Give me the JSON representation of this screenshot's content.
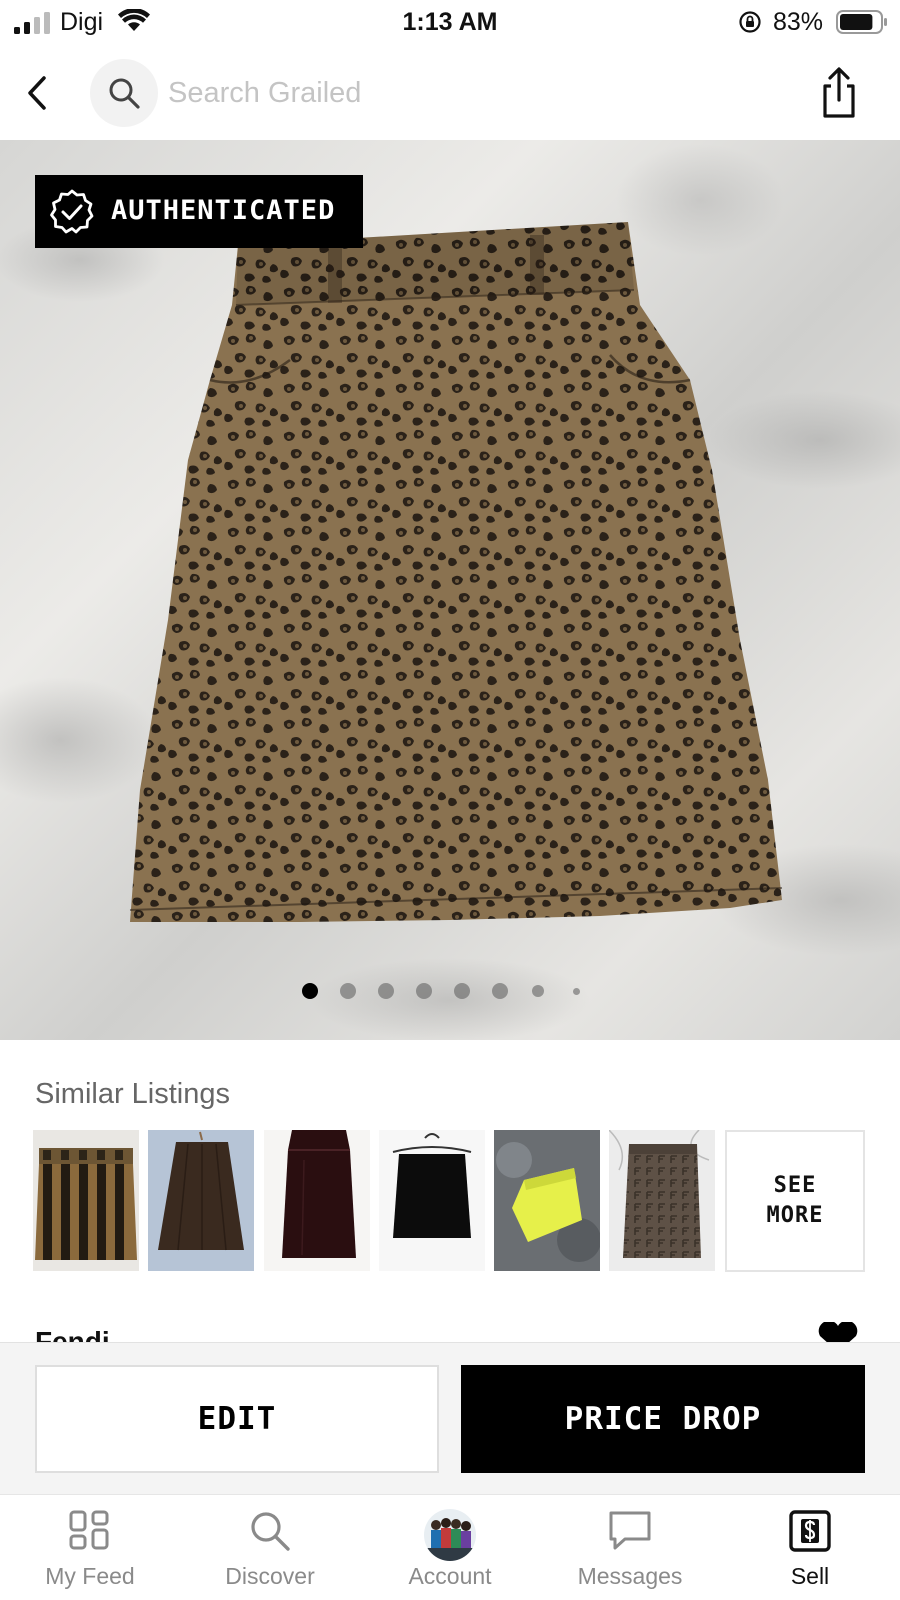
{
  "status_bar": {
    "carrier": "Digi",
    "time": "1:13 AM",
    "battery_percent": "83%",
    "battery_level": 0.83,
    "icons": [
      "signal-icon",
      "wifi-icon",
      "orientation-lock-icon",
      "battery-icon"
    ]
  },
  "nav": {
    "back_icon": "chevron-left-icon",
    "search_icon": "search-icon",
    "search_placeholder": "Search Grailed",
    "search_value": "",
    "share_icon": "share-icon"
  },
  "listing": {
    "badge": "AUTHENTICATED",
    "badge_icon": "verified-check-icon",
    "image_count": 8,
    "current_image": 1,
    "brand": "Fendi",
    "favorite_icon": "heart-icon"
  },
  "similar": {
    "title": "Similar Listings",
    "see_more": "SEE MORE",
    "thumbnails": [
      {
        "name": "striped-skirt-thumbnail"
      },
      {
        "name": "brown-pleated-skirt-thumbnail"
      },
      {
        "name": "velvet-mini-skirt-thumbnail"
      },
      {
        "name": "black-mini-skirt-thumbnail"
      },
      {
        "name": "yellow-skirt-thumbnail"
      },
      {
        "name": "monogram-skirt-thumbnail"
      }
    ]
  },
  "actions": {
    "edit": "EDIT",
    "price_drop": "PRICE DROP"
  },
  "tabs": [
    {
      "label": "My Feed",
      "icon": "feed-grid-icon",
      "active": false
    },
    {
      "label": "Discover",
      "icon": "search-icon",
      "active": false
    },
    {
      "label": "Account",
      "icon": "avatar",
      "active": false
    },
    {
      "label": "Messages",
      "icon": "message-bubble-icon",
      "active": false
    },
    {
      "label": "Sell",
      "icon": "sell-dollar-icon",
      "active": true
    }
  ],
  "colors": {
    "primary": "#000000",
    "background": "#ffffff",
    "action_bar": "#f4f4f4",
    "tab_inactive": "#8a8a8a",
    "placeholder": "#c4c4c4"
  }
}
